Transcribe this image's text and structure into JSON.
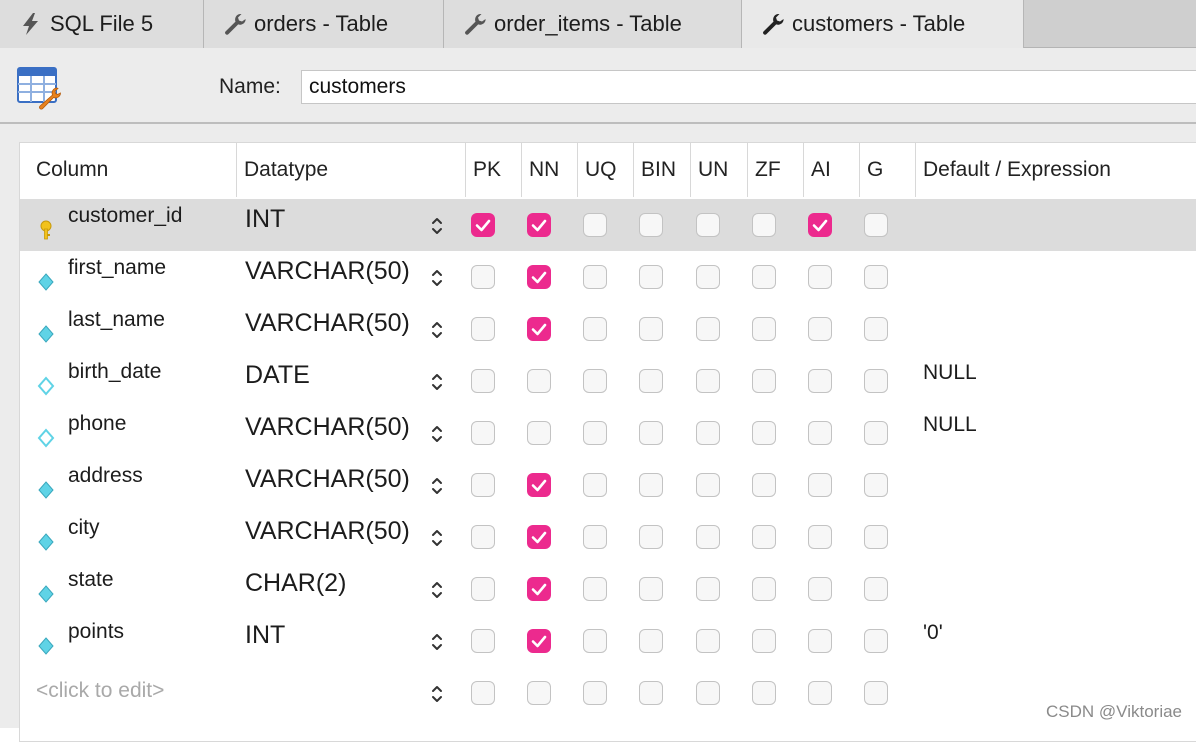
{
  "tabs": [
    {
      "label": "SQL File 5",
      "icon": "lightning-icon"
    },
    {
      "label": "orders - Table",
      "icon": "wrench-icon"
    },
    {
      "label": "order_items - Table",
      "icon": "wrench-icon"
    },
    {
      "label": "customers - Table",
      "icon": "wrench-icon",
      "active": true
    }
  ],
  "header": {
    "name_label": "Name:",
    "name_value": "customers",
    "icon": "table-edit-icon"
  },
  "grid": {
    "headers": {
      "column": "Column",
      "datatype": "Datatype",
      "flags": [
        "PK",
        "NN",
        "UQ",
        "BIN",
        "UN",
        "ZF",
        "AI",
        "G"
      ],
      "default": "Default / Expression"
    },
    "rows": [
      {
        "name": "customer_id",
        "type": "INT",
        "icon": "primary-key-icon",
        "flags": [
          true,
          true,
          false,
          false,
          false,
          false,
          true,
          false
        ],
        "default": "",
        "selected": true
      },
      {
        "name": "first_name",
        "type": "VARCHAR(50)",
        "icon": "column-nonnull-icon",
        "flags": [
          false,
          true,
          false,
          false,
          false,
          false,
          false,
          false
        ],
        "default": ""
      },
      {
        "name": "last_name",
        "type": "VARCHAR(50)",
        "icon": "column-nonnull-icon",
        "flags": [
          false,
          true,
          false,
          false,
          false,
          false,
          false,
          false
        ],
        "default": ""
      },
      {
        "name": "birth_date",
        "type": "DATE",
        "icon": "column-nullable-icon",
        "flags": [
          false,
          false,
          false,
          false,
          false,
          false,
          false,
          false
        ],
        "default": "NULL"
      },
      {
        "name": "phone",
        "type": "VARCHAR(50)",
        "icon": "column-nullable-icon",
        "flags": [
          false,
          false,
          false,
          false,
          false,
          false,
          false,
          false
        ],
        "default": "NULL"
      },
      {
        "name": "address",
        "type": "VARCHAR(50)",
        "icon": "column-nonnull-icon",
        "flags": [
          false,
          true,
          false,
          false,
          false,
          false,
          false,
          false
        ],
        "default": ""
      },
      {
        "name": "city",
        "type": "VARCHAR(50)",
        "icon": "column-nonnull-icon",
        "flags": [
          false,
          true,
          false,
          false,
          false,
          false,
          false,
          false
        ],
        "default": ""
      },
      {
        "name": "state",
        "type": "CHAR(2)",
        "icon": "column-nonnull-icon",
        "flags": [
          false,
          true,
          false,
          false,
          false,
          false,
          false,
          false
        ],
        "default": ""
      },
      {
        "name": "points",
        "type": "INT",
        "icon": "column-nonnull-icon",
        "flags": [
          false,
          true,
          false,
          false,
          false,
          false,
          false,
          false
        ],
        "default": "'0'"
      }
    ],
    "new_row_placeholder": "<click to edit>"
  },
  "colors": {
    "checkbox_on": "#ec2a8e",
    "selected_row": "#dcdcdc",
    "key_icon": "#f2c21b",
    "diamond_icon": "#5fd3e6"
  },
  "watermark": "CSDN @Viktoriae"
}
